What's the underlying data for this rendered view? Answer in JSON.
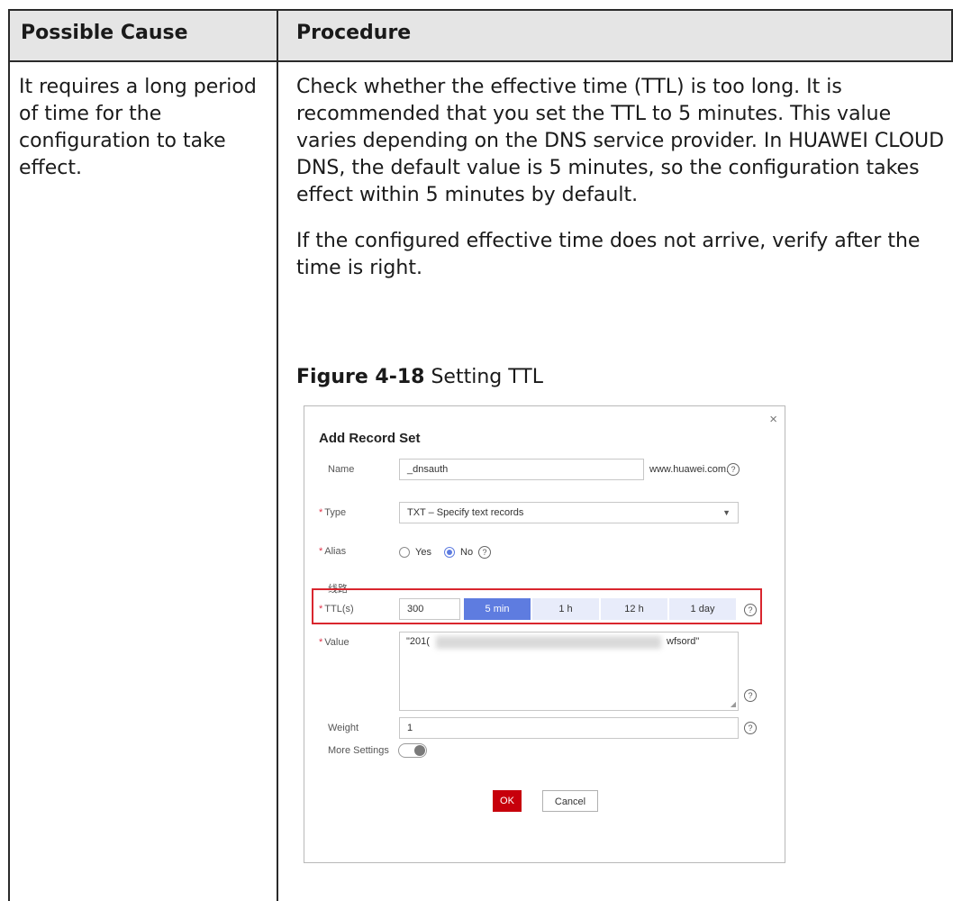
{
  "table": {
    "headers": [
      "Possible Cause",
      "Procedure"
    ],
    "cause": "It requires a long period of time for the configuration to take effect.",
    "procedure_p1": "Check whether the effective time (TTL) is too long. It is recommended that you set the TTL to 5 minutes. This value varies depending on the DNS service provider. In HUAWEI CLOUD DNS, the default value is 5 minutes, so the configuration takes effect within 5 minutes by default.",
    "procedure_p2": "If the configured effective time does not arrive, verify after the time is right."
  },
  "figure": {
    "number": "Figure 4-18",
    "title": "Setting TTL"
  },
  "dialog": {
    "title": "Add Record Set",
    "close": "×",
    "name_label": "Name",
    "name_value": "_dnsauth",
    "name_suffix": "www.huawei.com.",
    "required_mark": "*",
    "type_label": "Type",
    "type_value": "TXT – Specify text records",
    "alias_label": "Alias",
    "alias_options": [
      "Yes",
      "No"
    ],
    "alias_selected": "No",
    "line_label": "线路",
    "ttl_label": "TTL(s)",
    "ttl_value": "300",
    "ttl_presets": [
      "5 min",
      "1 h",
      "12 h",
      "1 day"
    ],
    "ttl_active": "5 min",
    "value_label": "Value",
    "value_start": "\"201(",
    "value_end": "wfsord\"",
    "weight_label": "Weight",
    "weight_value": "1",
    "more_label": "More Settings",
    "ok": "OK",
    "cancel": "Cancel",
    "help": "?"
  },
  "colors": {
    "accent": "#5e7ce0",
    "ok_button": "#c7000b",
    "highlight_border": "#d9262e",
    "required": "#e0344b"
  }
}
